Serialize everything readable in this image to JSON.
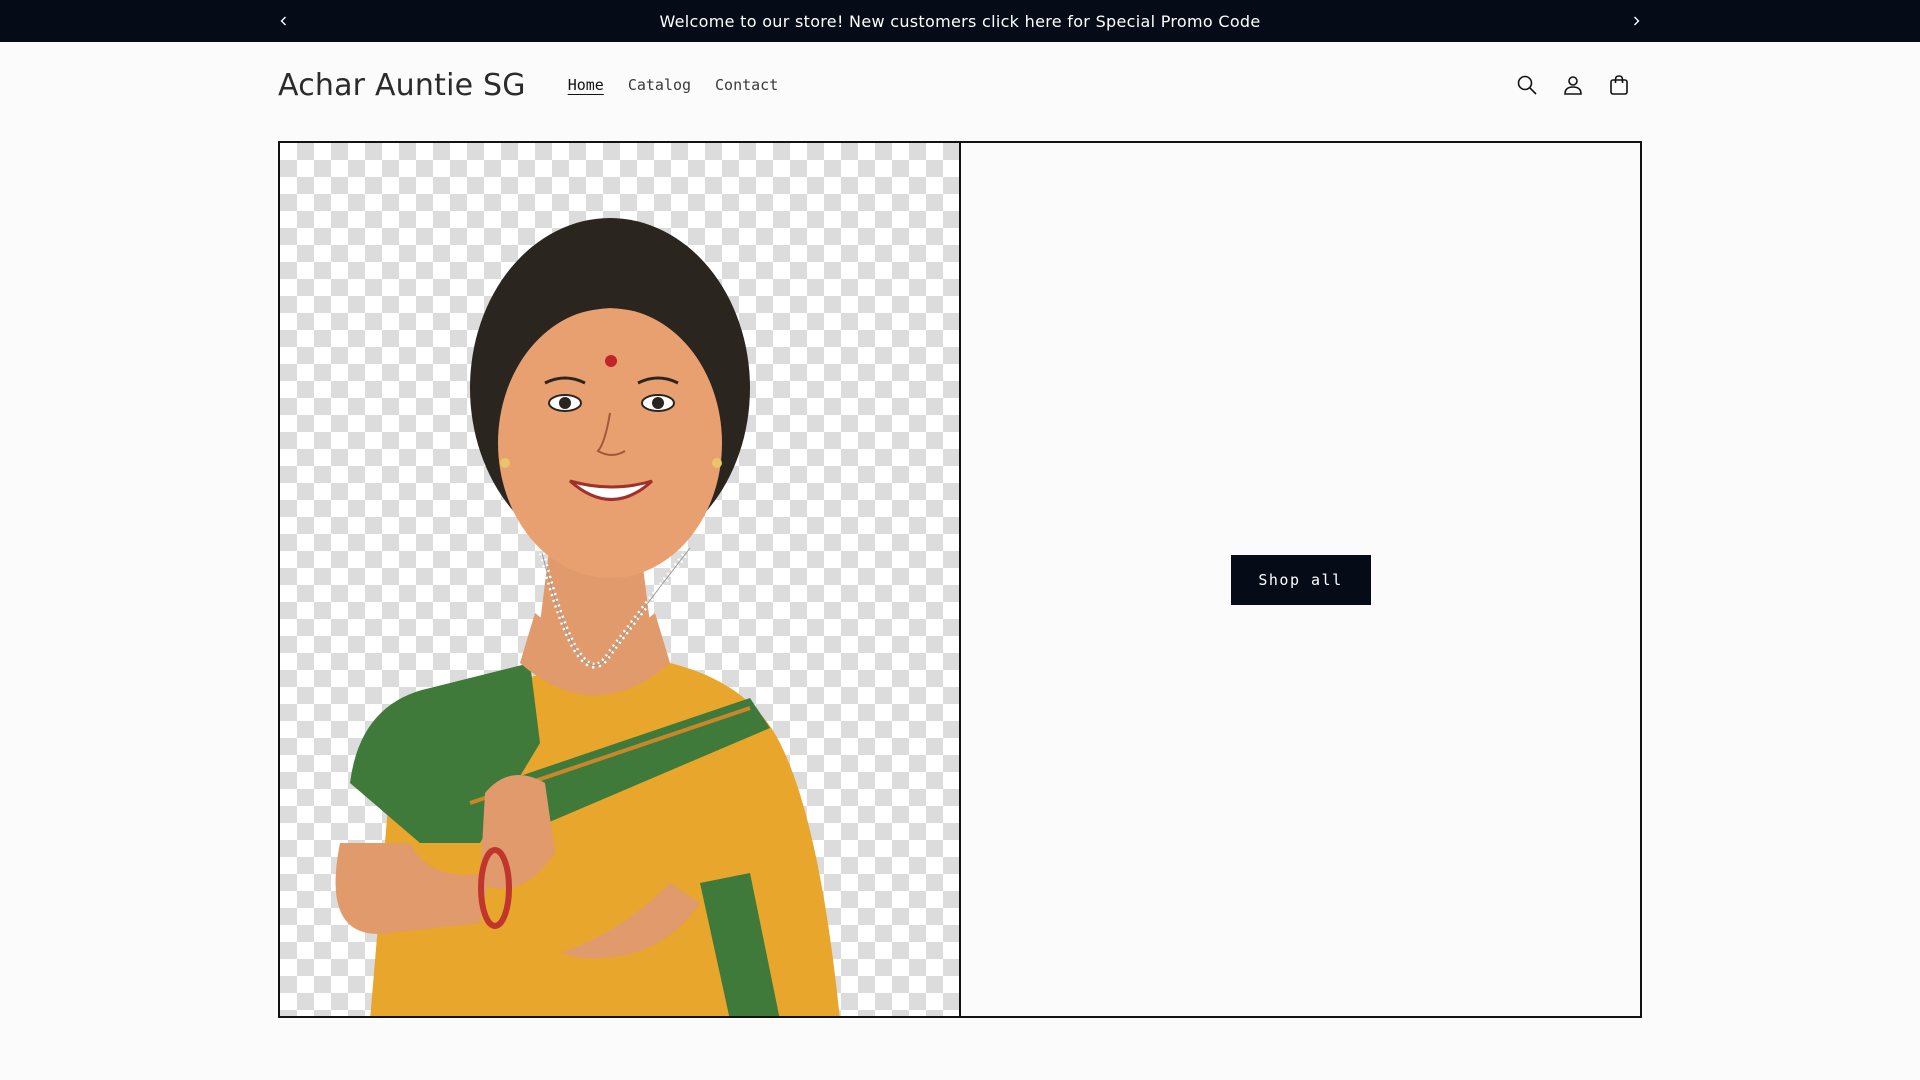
{
  "announcement": {
    "text": "Welcome to our store! New customers click here for Special Promo Code",
    "prev_icon": "chevron-left-icon",
    "next_icon": "chevron-right-icon"
  },
  "header": {
    "logo": "Achar Auntie SG",
    "nav": [
      {
        "label": "Home",
        "active": true
      },
      {
        "label": "Catalog",
        "active": false
      },
      {
        "label": "Contact",
        "active": false
      }
    ],
    "icons": [
      "search-icon",
      "account-icon",
      "cart-icon"
    ]
  },
  "hero": {
    "image": "illustration-auntie-in-saree",
    "cta_label": "Shop all"
  },
  "colors": {
    "announcement_bg": "#050b17",
    "button_bg": "#050b17",
    "page_bg": "#fbfbfb",
    "saree_yellow": "#e7a52d",
    "blouse_green": "#3f7a3a"
  }
}
